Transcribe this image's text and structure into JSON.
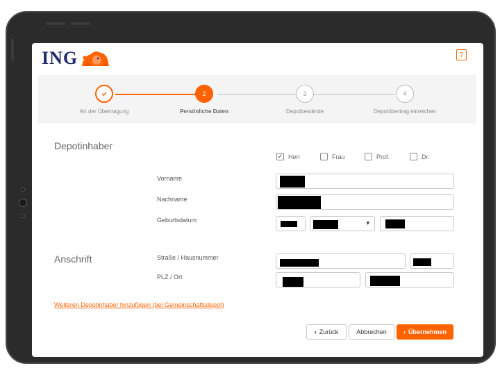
{
  "brand": {
    "name": "ING",
    "accent": "#ff6200",
    "navy": "#1f2a6b"
  },
  "header": {
    "help_label": "?"
  },
  "steps": [
    {
      "number": "1",
      "label": "Art der Übertragung",
      "state": "done"
    },
    {
      "number": "2",
      "label": "Persönliche Daten",
      "state": "active"
    },
    {
      "number": "3",
      "label": "Depotbestände",
      "state": "todo"
    },
    {
      "number": "4",
      "label": "Depotübertrag einreichen",
      "state": "todo"
    }
  ],
  "depotinhaber": {
    "title": "Depotinhaber",
    "salutations": [
      {
        "label": "Herr",
        "checked": true
      },
      {
        "label": "Frau",
        "checked": false
      },
      {
        "label": "Prof.",
        "checked": false
      },
      {
        "label": "Dr.",
        "checked": false
      }
    ],
    "vorname_label": "Vorname",
    "nachname_label": "Nachname",
    "geburtsdatum_label": "Geburtsdatum"
  },
  "anschrift": {
    "title": "Anschrift",
    "strasse_label": "Straße / Hausnummer",
    "plz_label": "PLZ / Ort"
  },
  "add_holder_link": "Weiteren Depotinhaber hinzufügen (bei Gemeinschaftsdepot)",
  "actions": {
    "back_label": "Zurück",
    "cancel_label": "Abbrechen",
    "submit_label": "Übernehmen"
  }
}
